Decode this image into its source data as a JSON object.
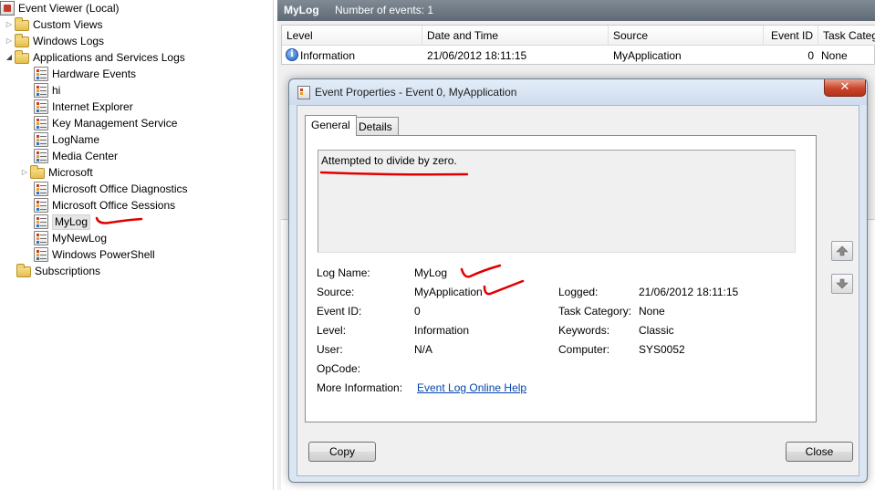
{
  "tree": {
    "items": [
      {
        "label": "Event Viewer (Local)",
        "icon": "event-viewer-icon",
        "expander": ""
      },
      {
        "label": "Custom Views",
        "icon": "folder-icon",
        "expander": "▷"
      },
      {
        "label": "Windows Logs",
        "icon": "folder-icon",
        "expander": "▷"
      },
      {
        "label": "Applications and Services Logs",
        "icon": "folder-icon",
        "expander": "◢"
      },
      {
        "label": "Hardware Events",
        "icon": "log-icon",
        "expander": ""
      },
      {
        "label": "hi",
        "icon": "log-icon",
        "expander": ""
      },
      {
        "label": "Internet Explorer",
        "icon": "log-icon",
        "expander": ""
      },
      {
        "label": "Key Management Service",
        "icon": "log-icon",
        "expander": ""
      },
      {
        "label": "LogName",
        "icon": "log-icon",
        "expander": ""
      },
      {
        "label": "Media Center",
        "icon": "log-icon",
        "expander": ""
      },
      {
        "label": "Microsoft",
        "icon": "folder-icon",
        "expander": "▷"
      },
      {
        "label": "Microsoft Office Diagnostics",
        "icon": "log-icon",
        "expander": ""
      },
      {
        "label": "Microsoft Office Sessions",
        "icon": "log-icon",
        "expander": ""
      },
      {
        "label": "MyLog",
        "icon": "log-icon",
        "expander": "",
        "selected": true
      },
      {
        "label": "MyNewLog",
        "icon": "log-icon",
        "expander": ""
      },
      {
        "label": "Windows PowerShell",
        "icon": "log-icon",
        "expander": ""
      },
      {
        "label": "Subscriptions",
        "icon": "subscriptions-icon",
        "expander": ""
      }
    ]
  },
  "header": {
    "log_name": "MyLog",
    "event_count": "Number of events: 1"
  },
  "grid": {
    "columns": [
      "Level",
      "Date and Time",
      "Source",
      "Event ID",
      "Task Category"
    ],
    "rows": [
      {
        "level": "Information",
        "date": "21/06/2012 18:11:15",
        "source": "MyApplication",
        "event_id": "0",
        "task_category": "None"
      }
    ]
  },
  "dialog": {
    "title": "Event Properties - Event 0, MyApplication",
    "close_glyph": "✕",
    "tabs": [
      "General",
      "Details"
    ],
    "description": "Attempted to divide by zero.",
    "fields": {
      "log_name_label": "Log Name:",
      "log_name": "MyLog",
      "source_label": "Source:",
      "source": "MyApplication",
      "logged_label": "Logged:",
      "logged": "21/06/2012 18:11:15",
      "event_id_label": "Event ID:",
      "event_id": "0",
      "task_category_label": "Task Category:",
      "task_category": "None",
      "level_label": "Level:",
      "level": "Information",
      "keywords_label": "Keywords:",
      "keywords": "Classic",
      "user_label": "User:",
      "user": "N/A",
      "computer_label": "Computer:",
      "computer": "SYS0052",
      "opcode_label": "OpCode:",
      "opcode": "",
      "more_info_label": "More Information:",
      "more_info_link": "Event Log Online Help"
    },
    "copy_label": "Copy",
    "close_label": "Close"
  },
  "colors": {
    "annotation": "#e00000",
    "link": "#0645ad",
    "close_button": "#c9452b"
  }
}
